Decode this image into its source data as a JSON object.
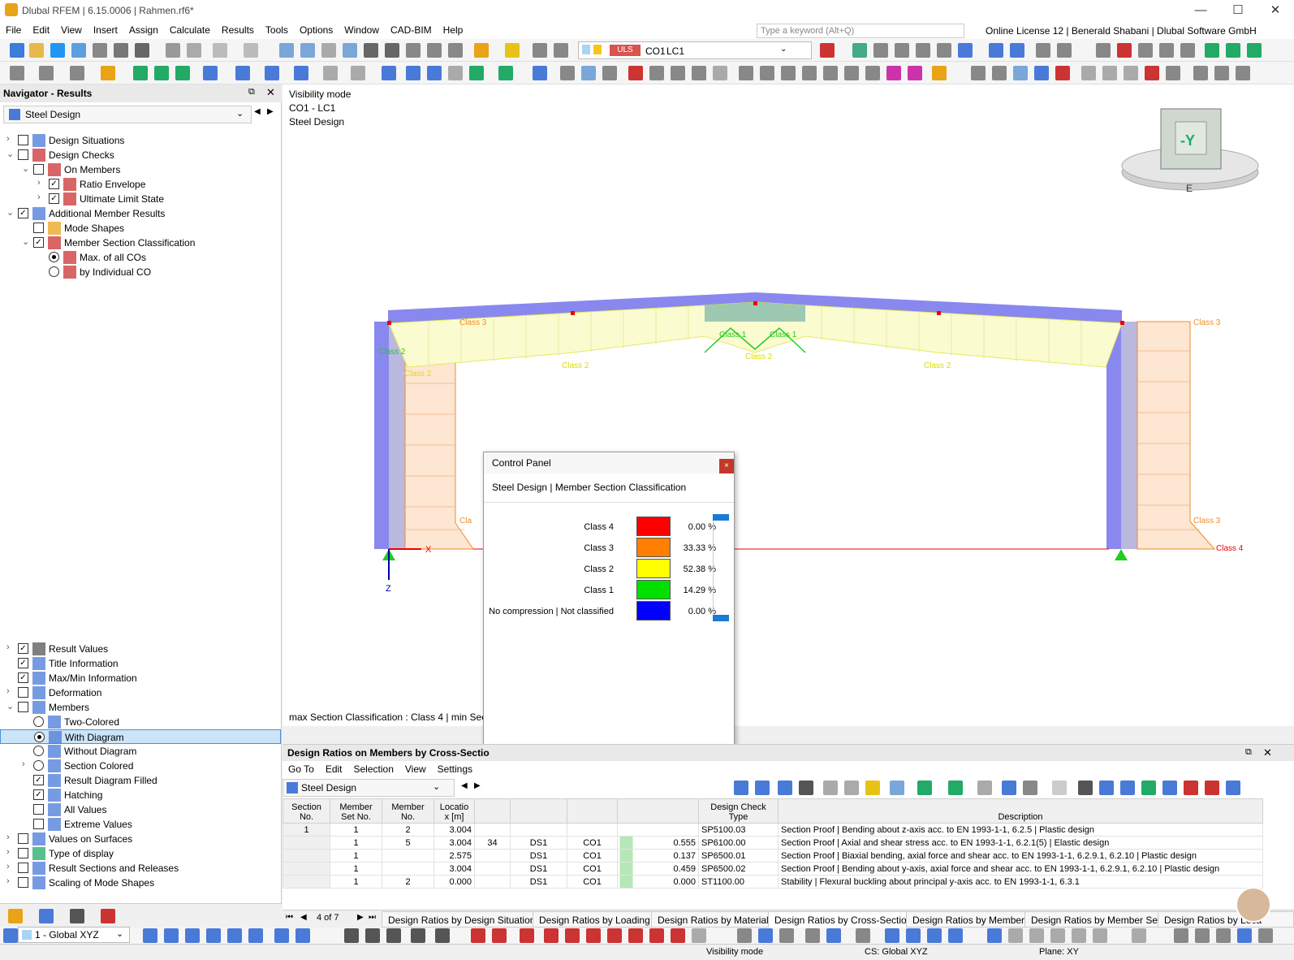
{
  "window": {
    "title": "Dlubal RFEM | 6.15.0006 | Rahmen.rf6*",
    "minimize": "—",
    "maximize": "☐",
    "close": "✕"
  },
  "menu": [
    "File",
    "Edit",
    "View",
    "Insert",
    "Assign",
    "Calculate",
    "Results",
    "Tools",
    "Options",
    "Window",
    "CAD-BIM",
    "Help"
  ],
  "search": {
    "placeholder": "Type a keyword (Alt+Q)"
  },
  "license": "Online License 12 | Benerald Shabani | Dlubal Software GmbH",
  "loadcase": {
    "type": "ULS",
    "combo": "CO1",
    "case": "LC1"
  },
  "navigator": {
    "title": "Navigator - Results",
    "module": "Steel Design",
    "top_items": [
      {
        "label": "Design Situations",
        "checked": false
      },
      {
        "label": "Design Checks",
        "checked": false
      },
      {
        "label": "On Members",
        "checked": false
      },
      {
        "label": "Ratio Envelope",
        "checked": true
      },
      {
        "label": "Ultimate Limit State",
        "checked": true
      },
      {
        "label": "Additional Member Results",
        "checked": true
      },
      {
        "label": "Mode Shapes",
        "checked": false
      },
      {
        "label": "Member Section Classification",
        "checked": true
      },
      {
        "label": "Max. of all COs",
        "checked": true
      },
      {
        "label": "by Individual CO",
        "checked": false
      }
    ],
    "bottom_items": [
      {
        "label": "Result Values",
        "checked": true
      },
      {
        "label": "Title Information",
        "checked": true
      },
      {
        "label": "Max/Min Information",
        "checked": true
      },
      {
        "label": "Deformation",
        "checked": false
      },
      {
        "label": "Members",
        "checked": false
      },
      {
        "label": "Two-Colored",
        "checked": false
      },
      {
        "label": "With Diagram",
        "checked": true
      },
      {
        "label": "Without Diagram",
        "checked": false
      },
      {
        "label": "Section Colored",
        "checked": false
      },
      {
        "label": "Result Diagram Filled",
        "checked": true
      },
      {
        "label": "Hatching",
        "checked": true
      },
      {
        "label": "All Values",
        "checked": false
      },
      {
        "label": "Extreme Values",
        "checked": false
      },
      {
        "label": "Values on Surfaces",
        "checked": false
      },
      {
        "label": "Type of display",
        "checked": false
      },
      {
        "label": "Result Sections and Releases",
        "checked": false
      },
      {
        "label": "Scaling of Mode Shapes",
        "checked": false
      }
    ]
  },
  "view": {
    "info_lines": [
      "Visibility mode",
      "CO1 - LC1",
      "Steel Design"
    ],
    "footer_info": "max Section Classification : Class 4 | min Sect",
    "cube_label": "-Y",
    "cube_dir": "E",
    "axis_x": "X",
    "axis_z": "Z",
    "class_labels": {
      "c3a": "Class 3",
      "c3b": "Class 3",
      "c3c": "Class 3",
      "c3d": "Class 3",
      "c4": "Class 4",
      "c2a": "Class 2",
      "c2b": "Class 2",
      "c2c": "Class 2",
      "c2d": "Class 2",
      "c2e": "Class 2",
      "c1a": "Class 1",
      "c1b": "Class 1",
      "cla": "Cla"
    }
  },
  "control_panel": {
    "title": "Control Panel",
    "close": "×",
    "subtitle": "Steel Design | Member Section Classification",
    "legend": [
      {
        "label": "Class 4",
        "color": "#ff0000",
        "percent": "0.00 %"
      },
      {
        "label": "Class 3",
        "color": "#ff8000",
        "percent": "33.33 %"
      },
      {
        "label": "Class 2",
        "color": "#ffff00",
        "percent": "52.38 %"
      },
      {
        "label": "Class 1",
        "color": "#00e000",
        "percent": "14.29 %"
      },
      {
        "label": "No compression | Not classified",
        "color": "#0000ff",
        "percent": "0.00 %"
      }
    ]
  },
  "results": {
    "title": "Design Ratios on Members by Cross-Sectio",
    "menu": [
      "Go To",
      "Edit",
      "Selection",
      "View",
      "Settings"
    ],
    "module": "Steel Design",
    "headers": {
      "section": "Section\nNo.",
      "memberset": "Member\nSet No.",
      "member": "Member\nNo.",
      "location": "Locatio\nx [m]",
      "checktype": "Design Check\nType",
      "description": "Description"
    },
    "rows": [
      {
        "section": "1",
        "memberset": "1",
        "member": "2",
        "location": "3.004",
        "ds": "",
        "co": "",
        "ratio": "",
        "check": "SP5100.03",
        "desc": "Section Proof | Bending about z-axis acc. to EN 1993-1-1, 6.2.5 | Plastic design"
      },
      {
        "section": "",
        "memberset": "1",
        "member": "5",
        "location": "3.004",
        "ds": "DS1",
        "co": "CO1",
        "ratio": "0.555",
        "check": "SP6100.00",
        "desc": "Section Proof | Axial and shear stress acc. to EN 1993-1-1, 6.2.1(5) | Elastic design"
      },
      {
        "section": "",
        "memberset": "1",
        "member": "",
        "location": "2.575",
        "ds": "DS1",
        "co": "CO1",
        "ratio": "0.137",
        "check": "SP6500.01",
        "desc": "Section Proof | Biaxial bending, axial force and shear acc. to EN 1993-1-1, 6.2.9.1, 6.2.10 | Plastic design"
      },
      {
        "section": "",
        "memberset": "1",
        "member": "",
        "location": "3.004",
        "ds": "DS1",
        "co": "CO1",
        "ratio": "0.459",
        "check": "SP6500.02",
        "desc": "Section Proof | Bending about y-axis, axial force and shear acc. to EN 1993-1-1, 6.2.9.1, 6.2.10 | Plastic design"
      },
      {
        "section": "",
        "memberset": "1",
        "member": "2",
        "location": "0.000",
        "ds": "DS1",
        "co": "CO1",
        "ratio": "0.000",
        "check": "ST1100.00",
        "desc": "Stability | Flexural buckling about principal y-axis acc. to EN 1993-1-1, 6.3.1"
      }
    ],
    "extra": "34",
    "pager": "4 of 7",
    "tabs": [
      "Design Ratios by Design Situation",
      "Design Ratios by Loading",
      "Design Ratios by Material",
      "Design Ratios by Cross-Section",
      "Design Ratios by Member",
      "Design Ratios by Member Set",
      "Design Ratios by Loca"
    ]
  },
  "bottom": {
    "coord_system": "1 - Global XYZ",
    "status_mode": "Visibility mode",
    "status_cs": "CS: Global XYZ",
    "status_plane": "Plane: XY"
  }
}
